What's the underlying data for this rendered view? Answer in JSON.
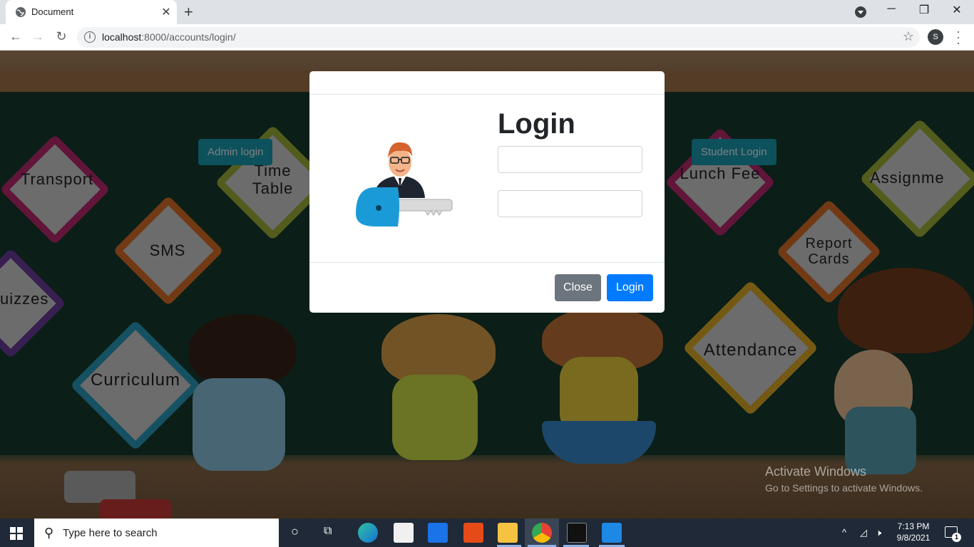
{
  "browser": {
    "tab_title": "Document",
    "tab_close": "✕",
    "new_tab": "+",
    "url_host": "localhost",
    "url_rest": ":8000/accounts/login/",
    "profile_initial": "S"
  },
  "page": {
    "admin_button": "Admin login",
    "student_button": "Student Login",
    "signs": [
      "Transport",
      "Time Table",
      "SMS",
      "uizzes",
      "Curriculum",
      "Lunch Fee",
      "Assignme",
      "Report Cards",
      "Attendance"
    ],
    "watermark_title": "Activate Windows",
    "watermark_sub": "Go to Settings to activate Windows."
  },
  "modal": {
    "title": "Login",
    "username_value": "",
    "password_value": "",
    "close_label": "Close",
    "login_label": "Login"
  },
  "taskbar": {
    "search_placeholder": "Type here to search",
    "time": "7:13 PM",
    "date": "9/8/2021",
    "notification_count": "1"
  },
  "colors": {
    "primary": "#007bff",
    "secondary": "#6c757d",
    "info": "#17a2b8"
  }
}
